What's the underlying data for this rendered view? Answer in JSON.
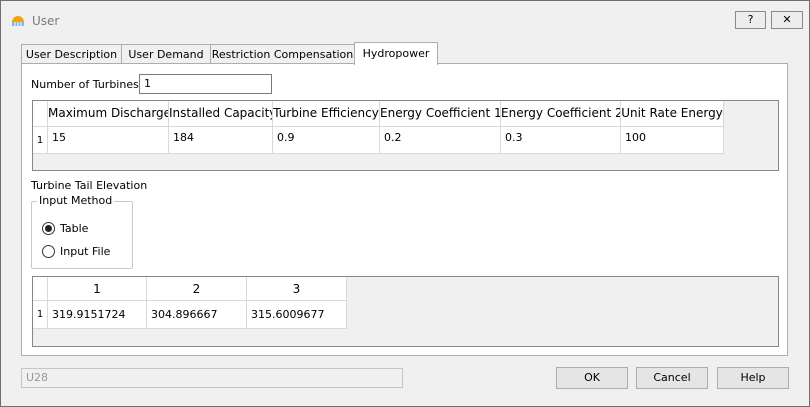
{
  "window": {
    "title": "User"
  },
  "titlebar": {
    "help_label": "?",
    "close_label": "✕"
  },
  "tabs": [
    {
      "label": "User Description"
    },
    {
      "label": "User Demand"
    },
    {
      "label": "Restriction Compensation"
    },
    {
      "label": "Hydropower"
    }
  ],
  "hydropower": {
    "turbines_label": "Number of Turbines",
    "turbines_value": "1",
    "turbine_grid": {
      "columns": [
        "Maximum Discharge",
        "Installed Capacity",
        "Turbine Efficiency",
        "Energy Coefficient 1",
        "Energy Coefficient 2",
        "Unit Rate Energy"
      ],
      "rows": [
        {
          "row_label": "1",
          "cells": [
            "15",
            "184",
            "0.9",
            "0.2",
            "0.3",
            "100"
          ]
        }
      ]
    },
    "tail_elevation_label": "Turbine Tail Elevation",
    "input_method": {
      "title": "Input Method",
      "options": [
        {
          "label": "Table",
          "checked": true
        },
        {
          "label": "Input File",
          "checked": false
        }
      ]
    },
    "tail_grid": {
      "columns": [
        "1",
        "2",
        "3"
      ],
      "rows": [
        {
          "row_label": "1",
          "cells": [
            "319.9151724",
            "304.896667",
            "315.6009677"
          ]
        }
      ]
    }
  },
  "footer": {
    "status_value": "U28",
    "ok_label": "OK",
    "cancel_label": "Cancel",
    "help_label": "Help"
  }
}
